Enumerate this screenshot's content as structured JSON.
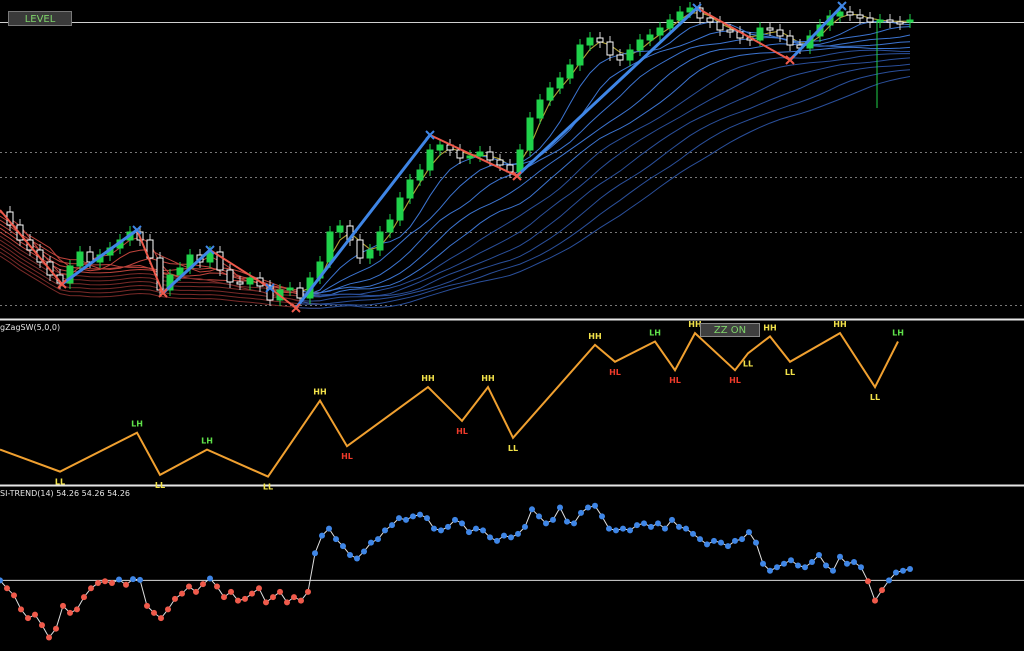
{
  "colors": {
    "background": "#000000",
    "candle_bull": "#1fd14a",
    "candle_bear": "#ffffff",
    "zigzag_main": "#3f86e6",
    "zigzag_down": "#ef5a4b",
    "swing_line": "#f0a030",
    "label_high": "#f2e24a",
    "label_green": "#5fe04a",
    "label_red": "#ef3a2a",
    "trend_up": "#3f86e6",
    "trend_down": "#ef5a4b",
    "level_line": "#d9d9d9"
  },
  "buttons": {
    "level": "LEVEL",
    "zz": "ZZ ON"
  },
  "panels": {
    "zigzag_title": "gZagSW(5,0,0)",
    "trend_title": "SI-TREND(14) 54.26 54.26 54.26"
  },
  "chart_data": [
    {
      "type": "line",
      "panel": "price",
      "x": [
        0,
        10,
        20,
        30,
        40,
        50,
        60,
        70,
        80,
        90,
        100,
        110,
        120,
        130,
        140,
        150,
        160,
        170,
        180,
        190,
        200,
        210,
        220,
        230,
        240,
        250,
        260,
        270,
        280,
        290,
        300,
        310,
        320,
        330,
        340,
        350,
        360,
        370,
        380,
        390,
        400,
        410,
        420,
        430,
        440,
        450,
        460,
        470,
        480,
        490,
        500,
        510,
        520,
        530,
        540,
        550,
        560,
        570,
        580,
        590,
        600,
        610,
        620,
        630,
        640,
        650,
        660,
        670,
        680,
        690,
        700,
        710,
        720,
        730,
        740,
        750,
        760,
        770,
        780,
        790,
        800,
        810,
        820,
        830,
        840,
        850,
        860,
        870,
        880,
        890,
        900,
        910
      ],
      "series": [
        {
          "values": [
            212,
            225,
            240,
            250,
            262,
            275,
            283,
            266,
            252,
            262,
            255,
            248,
            240,
            232,
            240,
            258,
            290,
            275,
            268,
            255,
            262,
            252,
            270,
            282,
            284,
            278,
            286,
            300,
            290,
            288,
            298,
            278,
            262,
            232,
            226,
            240,
            258,
            250,
            232,
            220,
            198,
            180,
            170,
            150,
            145,
            150,
            158,
            156,
            152,
            160,
            165,
            172,
            150,
            118,
            100,
            88,
            78,
            65,
            45,
            38,
            42,
            55,
            60,
            50,
            40,
            35,
            28,
            20,
            12,
            8,
            18,
            22,
            30,
            32,
            38,
            40,
            28,
            30,
            36,
            45,
            48,
            36,
            25,
            16,
            12,
            15,
            18,
            22,
            20,
            22,
            22,
            20
          ]
        }
      ],
      "zigzag": {
        "x": [
          0,
          62,
          137,
          163,
          210,
          270,
          296,
          430,
          517,
          697,
          790,
          842
        ],
        "y": [
          210,
          284,
          230,
          293,
          250,
          288,
          308,
          135,
          176,
          8,
          60,
          6
        ],
        "swing_labels": [
          "LL",
          "LH",
          "LL",
          "LH",
          "LL",
          "HH",
          "HL",
          "HH",
          "HL",
          "HH",
          "HL",
          "HH",
          "LL",
          "HH",
          "LL",
          "HH",
          "LL",
          "LH"
        ]
      },
      "moving_average_ribbon": {
        "bands": [
          "red",
          "blue"
        ],
        "count": 12
      }
    },
    {
      "type": "line",
      "panel": "zigzag",
      "x": [
        0,
        60,
        137,
        160,
        207,
        268,
        320,
        347,
        428,
        462,
        488,
        513,
        595,
        615,
        655,
        675,
        695,
        735,
        748,
        770,
        790,
        840,
        875,
        898
      ],
      "values": [
        -12,
        -25,
        -2,
        -27,
        -12,
        -28,
        17,
        -10,
        25,
        5,
        25,
        -5,
        50,
        40,
        52,
        35,
        57,
        35,
        45,
        55,
        40,
        57,
        25,
        52
      ],
      "ylim": [
        -30,
        60
      ],
      "labels": [
        "",
        "LL",
        "LH",
        "LL",
        "LH",
        "LL",
        "HH",
        "HL",
        "HH",
        "HL",
        "HH",
        "LL",
        "HH",
        "HL",
        "LH",
        "HL",
        "HH",
        "HL",
        "LL",
        "HH",
        "LL",
        "HH",
        "LL",
        "LH"
      ]
    },
    {
      "type": "scatter",
      "panel": "trend",
      "level": 54.26,
      "x": [
        0,
        7,
        14,
        21,
        28,
        35,
        42,
        49,
        56,
        63,
        70,
        77,
        84,
        91,
        98,
        105,
        112,
        119,
        126,
        133,
        140,
        147,
        154,
        161,
        168,
        175,
        182,
        189,
        196,
        203,
        210,
        217,
        224,
        231,
        238,
        245,
        252,
        259,
        266,
        273,
        280,
        287,
        294,
        301,
        308,
        315,
        322,
        329,
        336,
        343,
        350,
        357,
        364,
        371,
        378,
        385,
        392,
        399,
        406,
        413,
        420,
        427,
        434,
        441,
        448,
        455,
        462,
        469,
        476,
        483,
        490,
        497,
        504,
        511,
        518,
        525,
        532,
        539,
        546,
        553,
        560,
        567,
        574,
        581,
        588,
        595,
        602,
        609,
        616,
        623,
        630,
        637,
        644,
        651,
        658,
        665,
        672,
        679,
        686,
        693,
        700,
        707,
        714,
        721,
        728,
        735,
        742,
        749,
        756,
        763,
        770,
        777,
        784,
        791,
        798,
        805,
        812,
        819,
        826,
        833,
        840,
        847,
        854,
        861,
        868,
        875,
        882,
        889,
        896,
        903,
        910
      ],
      "values": [
        54.26,
        52.0,
        50.0,
        46.0,
        43.5,
        44.5,
        41.5,
        38.0,
        40.5,
        47.0,
        45.0,
        46.0,
        49.5,
        52.0,
        53.5,
        54.0,
        53.5,
        54.5,
        53.0,
        54.6,
        54.4,
        47.0,
        45.0,
        43.5,
        46.0,
        49.0,
        50.5,
        52.5,
        51.0,
        53.2,
        54.8,
        52.5,
        49.5,
        51.0,
        48.5,
        49.0,
        50.5,
        52.0,
        48.0,
        49.5,
        51.0,
        48.0,
        49.5,
        48.5,
        51.0,
        62.0,
        67.0,
        69.0,
        66.0,
        64.0,
        61.5,
        60.5,
        62.5,
        65.0,
        66.0,
        68.5,
        70.0,
        72.0,
        71.5,
        72.5,
        73.0,
        72.0,
        69.0,
        68.5,
        69.5,
        71.5,
        70.5,
        68.0,
        69.0,
        68.5,
        66.5,
        65.5,
        67.0,
        66.5,
        67.5,
        69.5,
        74.5,
        72.5,
        70.5,
        71.5,
        75.0,
        71.0,
        70.5,
        73.5,
        75.0,
        75.5,
        72.5,
        69.0,
        68.5,
        69.0,
        68.5,
        70.0,
        70.5,
        69.5,
        70.5,
        69.0,
        71.5,
        69.5,
        69.0,
        67.5,
        66.0,
        64.5,
        65.5,
        65.0,
        64.0,
        65.5,
        66.0,
        68.0,
        65.0,
        59.0,
        57.0,
        58.0,
        59.0,
        60.0,
        58.5,
        58.0,
        59.5,
        61.5,
        58.5,
        57.0,
        61.0,
        59.0,
        59.5,
        58.0,
        54.0,
        48.5,
        51.5,
        54.26,
        56.5,
        57.0,
        57.5
      ],
      "ylim": [
        35,
        80
      ]
    }
  ]
}
